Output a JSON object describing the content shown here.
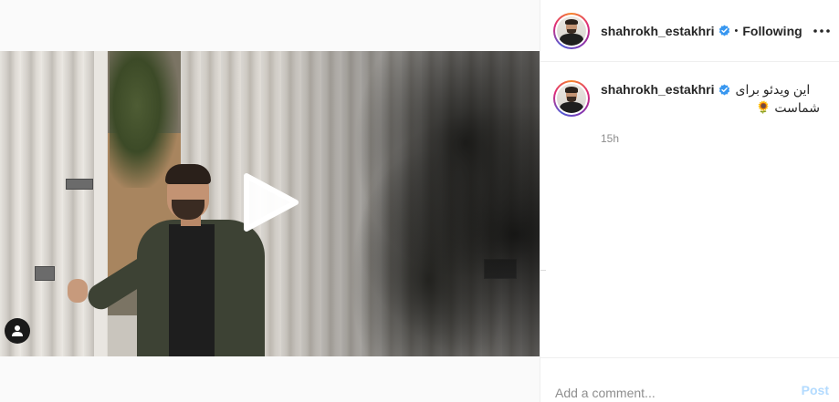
{
  "post": {
    "username": "shahrokh_estakhri",
    "follow_status": "Following",
    "separator": "•",
    "caption_line1": "این ویدئو برای",
    "caption_line2": "شماست",
    "caption_emoji": "🌻",
    "timestamp": "15h"
  },
  "comment": {
    "placeholder": "Add a comment...",
    "post_label": "Post"
  },
  "icons": {
    "more": "more-options-icon",
    "verified": "verified-badge-icon",
    "play": "play-icon",
    "tag": "user-tag-icon"
  },
  "colors": {
    "verified_blue": "#3897f0",
    "post_disabled": "#b3dbff",
    "muted": "#8e8e8e"
  }
}
